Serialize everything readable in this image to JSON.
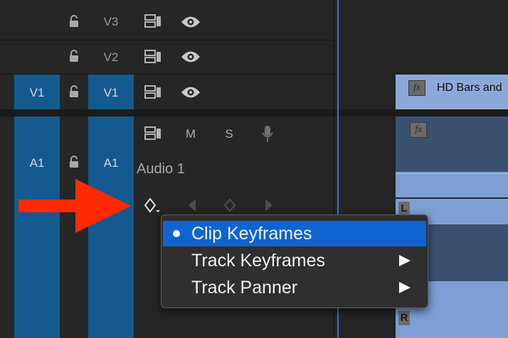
{
  "tracks": {
    "v3": {
      "target_label": "V3"
    },
    "v2": {
      "target_label": "V2"
    },
    "v1": {
      "source_label": "V1",
      "target_label": "V1"
    },
    "a1": {
      "source_label": "A1",
      "target_label": "A1",
      "name": "Audio 1",
      "mute_label": "M",
      "solo_label": "S"
    }
  },
  "clips": {
    "video_clip_title": "HD Bars and",
    "fx_label": "fx",
    "audio_left_channel": "L",
    "audio_right_channel": "R"
  },
  "context_menu": {
    "items": [
      {
        "label": "Clip Keyframes",
        "selected": true,
        "submenu": false
      },
      {
        "label": "Track Keyframes",
        "selected": false,
        "submenu": true
      },
      {
        "label": "Track Panner",
        "selected": false,
        "submenu": true
      }
    ]
  },
  "colors": {
    "panel_bg": "#232323",
    "track_target_blue": "#155a8e",
    "clip_blue": "#7d9fd3",
    "menu_highlight": "#0e64d1",
    "annotation_arrow": "#ff2a00"
  }
}
